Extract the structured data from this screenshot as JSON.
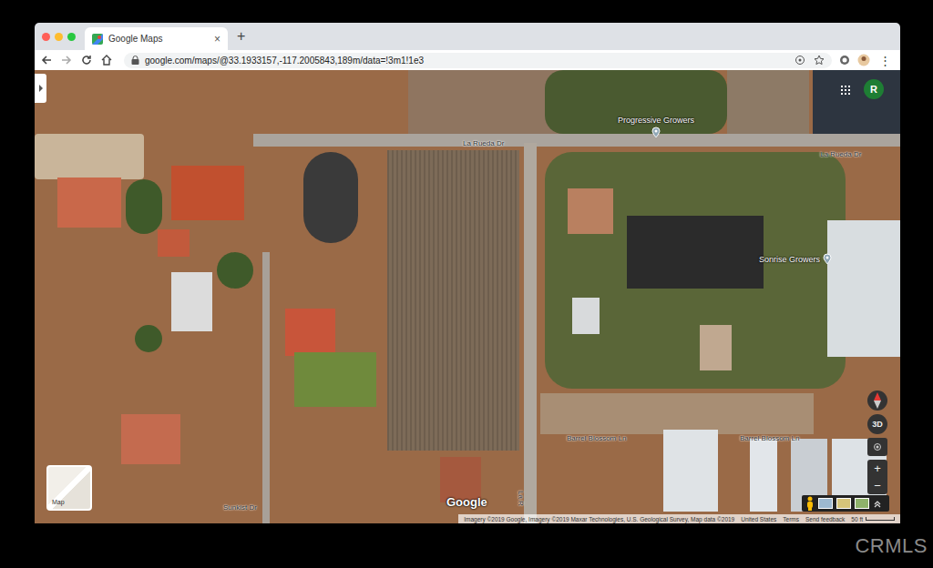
{
  "browser": {
    "tabs": [
      {
        "label": "Google Maps",
        "selected": true,
        "close": "×"
      }
    ],
    "new_tab": "+",
    "url": "google.com/maps/@33.1933157,-117.2005843,189m/data=!3m1!1e3",
    "menu": "⋮"
  },
  "map": {
    "profile": "R",
    "labels": [
      {
        "text": "La Rueda Dr",
        "kind": "road"
      },
      {
        "text": "La Rueda Dr",
        "kind": "road"
      },
      {
        "text": "Progressive Growers",
        "kind": "place-above"
      },
      {
        "text": "Sonrise Growers",
        "kind": "place-right"
      },
      {
        "text": "Barrel Blossom Ln",
        "kind": "road"
      },
      {
        "text": "Barrel Blossom Ln",
        "kind": "road"
      },
      {
        "text": "Sunkist Dr",
        "kind": "road"
      },
      {
        "text": "La R",
        "kind": "road-vertical"
      }
    ],
    "layer_toggle": "Map",
    "controls": {
      "three_d": "3D",
      "zoom_in": "+",
      "zoom_out": "−"
    },
    "logo": "Google",
    "footer": [
      "Imagery ©2019 Google, Imagery ©2019 Maxar Technologies, U.S. Geological Survey, Map data ©2019",
      "United States",
      "Terms",
      "Send feedback"
    ],
    "scale": "50 ft"
  },
  "watermark": "CRMLS"
}
